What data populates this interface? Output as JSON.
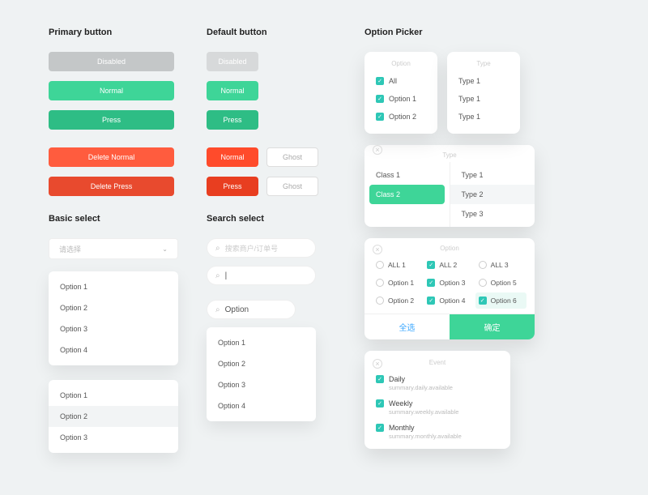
{
  "primary": {
    "title": "Primary button",
    "disabled": "Disabled",
    "normal": "Normal",
    "press": "Press",
    "deleteNormal": "Delete Normal",
    "deletePress": "Delete Press"
  },
  "default": {
    "title": "Default button",
    "disabled": "Disabled",
    "normal": "Normal",
    "press": "Press",
    "dangerNormal": "Normal",
    "dangerPress": "Press",
    "ghost": "Ghost"
  },
  "basicSelect": {
    "title": "Basic select",
    "placeholder": "请选择",
    "options": [
      "Option 1",
      "Option 2",
      "Option 3",
      "Option 4"
    ],
    "options2": [
      "Option 1",
      "Option 2",
      "Option 3"
    ]
  },
  "searchSelect": {
    "title": "Search select",
    "placeholder": "搜索商户/订单号",
    "typed": "Option",
    "options": [
      "Option 1",
      "Option 2",
      "Option 3",
      "Option 4"
    ]
  },
  "optionPicker": {
    "title": "Option Picker",
    "optionHead": "Option",
    "typeHead": "Type",
    "optList": [
      "All",
      "Option 1",
      "Option 2"
    ],
    "typeList": [
      "Type 1",
      "Type 1",
      "Type 1"
    ],
    "dualLeft": [
      "Class 1",
      "Class 2"
    ],
    "dualRight": [
      "Type 1",
      "Type 2",
      "Type 3"
    ],
    "gridHead": "Option",
    "grid": [
      "ALL 1",
      "ALL 2",
      "ALL 3",
      "Option 1",
      "Option 3",
      "Option 5",
      "Option 2",
      "Option 4",
      "Option 6"
    ],
    "gridAll": "全选",
    "gridOk": "确定",
    "eventHead": "Event",
    "events": [
      {
        "title": "Daily",
        "sub": "summary.daily.available"
      },
      {
        "title": "Weekly",
        "sub": "summary.weekly.available"
      },
      {
        "title": "Monthly",
        "sub": "summary.monthly.available"
      }
    ]
  }
}
